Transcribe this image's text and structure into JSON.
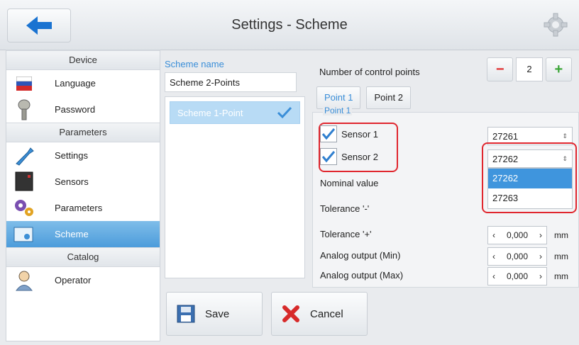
{
  "header": {
    "title": "Settings - Scheme",
    "back_icon": "back-arrow-icon",
    "gear_icon": "gear-icon"
  },
  "sidebar": {
    "sections": [
      {
        "title": "Device",
        "items": [
          {
            "label": "Language",
            "icon": "flag-icon"
          },
          {
            "label": "Password",
            "icon": "key-icon"
          }
        ]
      },
      {
        "title": "Parameters",
        "items": [
          {
            "label": "Settings",
            "icon": "wrench-icon"
          },
          {
            "label": "Sensors",
            "icon": "sensor-icon"
          },
          {
            "label": "Parameters",
            "icon": "gears-icon"
          },
          {
            "label": "Scheme",
            "icon": "scheme-icon",
            "active": true
          }
        ]
      },
      {
        "title": "Catalog",
        "items": [
          {
            "label": "Operator",
            "icon": "user-icon"
          }
        ]
      }
    ]
  },
  "scheme": {
    "name_label": "Scheme name",
    "name_value": "Scheme 2-Points",
    "list": [
      {
        "label": "Scheme 1-Point",
        "checked": true
      }
    ]
  },
  "control_points": {
    "label": "Number of control points",
    "minus": "−",
    "plus": "+",
    "value": "2",
    "tabs": [
      "Point 1",
      "Point 2"
    ],
    "group_title": "Point 1",
    "sensor1": {
      "label": "Sensor 1",
      "checked": true,
      "value": "27261"
    },
    "sensor2": {
      "label": "Sensor 2",
      "checked": true,
      "value": "27262"
    },
    "dropdown_options": [
      "27262",
      "27263"
    ],
    "fields": [
      {
        "label": "Nominal value"
      },
      {
        "label": "Tolerance '-'"
      },
      {
        "label": "Tolerance '+'",
        "value": "0,000",
        "unit": "mm"
      },
      {
        "label": "Analog output (Min)",
        "value": "0,000",
        "unit": "mm"
      },
      {
        "label": "Analog output (Max)",
        "value": "0,000",
        "unit": "mm"
      }
    ]
  },
  "actions": {
    "save": "Save",
    "cancel": "Cancel"
  },
  "colors": {
    "accent": "#3a8ed8",
    "active": "#4c9cdb",
    "highlight_box": "#e0262e"
  }
}
